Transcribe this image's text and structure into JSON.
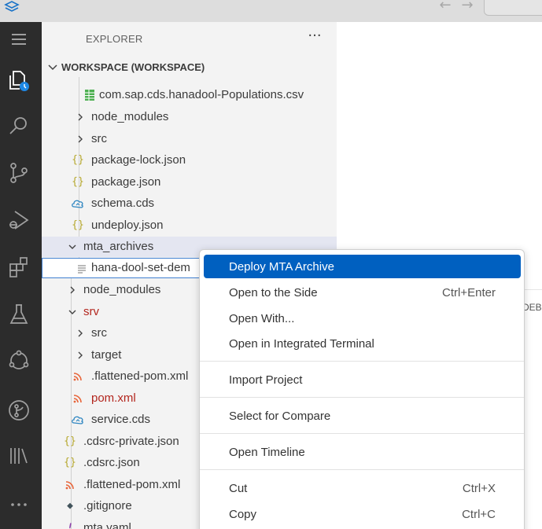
{
  "titlebar": {
    "back_icon": "arrow-left-icon",
    "forward_icon": "arrow-right-icon"
  },
  "activity_bar": {
    "items": [
      {
        "name": "menu-icon"
      },
      {
        "name": "explorer-icon"
      },
      {
        "name": "search-icon"
      },
      {
        "name": "source-control-icon"
      },
      {
        "name": "run-debug-icon"
      },
      {
        "name": "extensions-icon"
      },
      {
        "name": "testing-icon"
      },
      {
        "name": "sap-fiori-icon"
      },
      {
        "name": "git-graph-icon"
      },
      {
        "name": "library-icon"
      },
      {
        "name": "more-icon"
      }
    ]
  },
  "sidebar": {
    "title": "EXPLORER",
    "more_actions": "···",
    "workspace_title": "WORKSPACE (WORKSPACE)"
  },
  "tree": [
    {
      "label": "com.sap.cds.hanadool-Populations.csv",
      "icon": "csv-table-icon",
      "color": "#4caf50",
      "chevron": "none"
    },
    {
      "label": "node_modules",
      "icon": "none",
      "chevron": "right"
    },
    {
      "label": "src",
      "icon": "none",
      "chevron": "right"
    },
    {
      "label": "package-lock.json",
      "icon": "json-braces-icon",
      "glyph": "{}",
      "color": "#b5a72c",
      "chevron": "none"
    },
    {
      "label": "package.json",
      "icon": "json-braces-icon",
      "glyph": "{}",
      "color": "#b5a72c",
      "chevron": "none"
    },
    {
      "label": "schema.cds",
      "icon": "cds-cloud-icon",
      "color": "#2e86c1",
      "chevron": "none"
    },
    {
      "label": "undeploy.json",
      "icon": "json-braces-icon",
      "glyph": "{}",
      "color": "#b5a72c",
      "chevron": "none"
    },
    {
      "label": "mta_archives",
      "icon": "none",
      "chevron": "down"
    },
    {
      "label": "hana-dool-set-dem",
      "icon": "file-lines-icon",
      "glyph": "≡",
      "color": "#8a8a8a",
      "chevron": "none"
    },
    {
      "label": "node_modules",
      "icon": "none",
      "chevron": "right"
    },
    {
      "label": "srv",
      "icon": "none",
      "chevron": "down"
    },
    {
      "label": "src",
      "icon": "none",
      "chevron": "right"
    },
    {
      "label": "target",
      "icon": "none",
      "chevron": "right"
    },
    {
      "label": ".flattened-pom.xml",
      "icon": "rss-icon",
      "glyph": "ȷ",
      "color": "#e8653a",
      "chevron": "none"
    },
    {
      "label": "pom.xml",
      "icon": "rss-icon",
      "glyph": "ȷ",
      "color": "#e8653a",
      "chevron": "none"
    },
    {
      "label": "service.cds",
      "icon": "cds-cloud-icon",
      "color": "#2e86c1",
      "chevron": "none"
    },
    {
      "label": ".cdsrc-private.json",
      "icon": "json-braces-icon",
      "glyph": "{}",
      "color": "#b5a72c",
      "chevron": "none"
    },
    {
      "label": ".cdsrc.json",
      "icon": "json-braces-icon",
      "glyph": "{}",
      "color": "#b5a72c",
      "chevron": "none"
    },
    {
      "label": ".flattened-pom.xml",
      "icon": "rss-icon",
      "glyph": "ȷ",
      "color": "#e8653a",
      "chevron": "none"
    },
    {
      "label": ".gitignore",
      "icon": "git-diamond-icon",
      "glyph": "◆",
      "color": "#41535b",
      "chevron": "none"
    },
    {
      "label": "mta.yaml",
      "icon": "yaml-icon",
      "glyph": "!",
      "color": "#8e44ad",
      "chevron": "none"
    }
  ],
  "panel": {
    "tab_fragment": "DEB"
  },
  "context_menu": {
    "groups": [
      [
        {
          "label": "Deploy MTA Archive",
          "shortcut": "",
          "selected": true
        },
        {
          "label": "Open to the Side",
          "shortcut": "Ctrl+Enter"
        },
        {
          "label": "Open With...",
          "shortcut": ""
        },
        {
          "label": "Open in Integrated Terminal",
          "shortcut": ""
        }
      ],
      [
        {
          "label": "Import Project",
          "shortcut": ""
        }
      ],
      [
        {
          "label": "Select for Compare",
          "shortcut": ""
        }
      ],
      [
        {
          "label": "Open Timeline",
          "shortcut": ""
        }
      ],
      [
        {
          "label": "Cut",
          "shortcut": "Ctrl+X"
        },
        {
          "label": "Copy",
          "shortcut": "Ctrl+C"
        }
      ]
    ]
  },
  "colors": {
    "activity_bar": "#2c2c2c",
    "sidebar": "#f3f3f3",
    "menu_selected": "#0060c0",
    "focus_border": "#3f7fd1"
  }
}
